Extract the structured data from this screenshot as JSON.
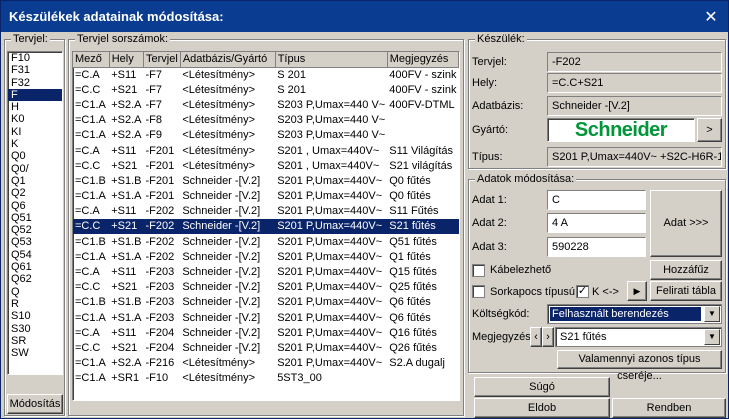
{
  "window": {
    "title": "Készülékek adatainak módosítása:",
    "close_glyph": "✕"
  },
  "left": {
    "legend": "Tervjel:",
    "items": [
      "F10",
      "F31",
      "F32",
      "F",
      "H",
      "K0",
      "KI",
      "K",
      "Q0",
      "Q0/",
      "Q1",
      "Q2",
      "Q6",
      "Q51",
      "Q52",
      "Q53",
      "Q54",
      "Q61",
      "Q62",
      "Q",
      "R",
      "S10",
      "S30",
      "SR",
      "SW"
    ],
    "selected_index": 3,
    "modositas_button": "Módosítás"
  },
  "table": {
    "legend": "Tervjel sorszámok:",
    "columns": [
      "Mező",
      "Hely",
      "Tervjel",
      "Adatbázis/Gyártó",
      "Típus",
      "Megjegyzés"
    ],
    "selected_row": 10,
    "rows": [
      [
        "=C.A",
        "+S11",
        "-F7",
        "<Létesítmény>",
        "S 201",
        "400FV - szink"
      ],
      [
        "=C.C",
        "+S21",
        "-F7",
        "<Létesítmény>",
        "S 201",
        "400FV - szink"
      ],
      [
        "=C1.A",
        "+S2.A",
        "-F7",
        "<Létesítmény>",
        "S203 P,Umax=440 V~",
        "400FV-DTML"
      ],
      [
        "=C1.A",
        "+S2.A",
        "-F8",
        "<Létesítmény>",
        "S203 P,Umax=440 V~",
        ""
      ],
      [
        "=C1.A",
        "+S2.A",
        "-F9",
        "<Létesítmény>",
        "S203 P,Umax=440 V~",
        ""
      ],
      [
        "=C.A",
        "+S11",
        "-F201",
        "<Létesítmény>",
        "S201 , Umax=440V~",
        "S11 Világítás"
      ],
      [
        "=C.C",
        "+S21",
        "-F201",
        "<Létesítmény>",
        "S201 , Umax=440V~",
        "S21 világítás"
      ],
      [
        "=C1.B",
        "+S1.B",
        "-F201",
        "Schneider -[V.2]",
        "S201 P,Umax=440V~",
        "Q0 fűtés"
      ],
      [
        "=C1.A",
        "+S1.A",
        "-F201",
        "Schneider -[V.2]",
        "S201 P,Umax=440V~",
        "Q0 fűtés"
      ],
      [
        "=C.A",
        "+S11",
        "-F202",
        "Schneider -[V.2]",
        "S201 P,Umax=440V~",
        "S11 Fűtés"
      ],
      [
        "=C.C",
        "+S21",
        "-F202",
        "Schneider -[V.2]",
        "S201 P,Umax=440V~",
        "S21 fűtés"
      ],
      [
        "=C1.B",
        "+S1.B",
        "-F202",
        "Schneider -[V.2]",
        "S201 P,Umax=440V~",
        "Q51 fűtés"
      ],
      [
        "=C1.A",
        "+S1.A",
        "-F202",
        "Schneider -[V.2]",
        "S201 P,Umax=440V~",
        "Q1 fűtés"
      ],
      [
        "=C.A",
        "+S11",
        "-F203",
        "Schneider -[V.2]",
        "S201 P,Umax=440V~",
        "Q15 fűtés"
      ],
      [
        "=C.C",
        "+S21",
        "-F203",
        "Schneider -[V.2]",
        "S201 P,Umax=440V~",
        "Q25 fűtés"
      ],
      [
        "=C1.B",
        "+S1.B",
        "-F203",
        "Schneider -[V.2]",
        "S201 P,Umax=440V~",
        "Q6 fűtés"
      ],
      [
        "=C1.A",
        "+S1.A",
        "-F203",
        "Schneider -[V.2]",
        "S201 P,Umax=440V~",
        "Q6 fűtés"
      ],
      [
        "=C.A",
        "+S11",
        "-F204",
        "Schneider -[V.2]",
        "S201 P,Umax=440V~",
        "Q16 fűtés"
      ],
      [
        "=C.C",
        "+S21",
        "-F204",
        "Schneider -[V.2]",
        "S201 P,Umax=440V~",
        "Q26 fűtés"
      ],
      [
        "=C1.A",
        "+S2.A",
        "-F216",
        "<Létesítmény>",
        "S201 P,Umax=440V~",
        "S2.A dugalj"
      ],
      [
        "=C1.A",
        "+SR1",
        "-F10",
        "<Létesítmény>",
        "5ST3_00",
        ""
      ]
    ]
  },
  "keszulek": {
    "legend": "Készülék:",
    "tervjel_label": "Tervjel:",
    "tervjel_value": "-F202",
    "hely_label": "Hely:",
    "hely_value": "=C.C+S21",
    "adatbazis_label": "Adatbázis:",
    "adatbazis_value": "Schneider -[V.2]",
    "gyarto_label": "Gyártó:",
    "gyarto_logo": "Schneider",
    "gyarto_btn": ">",
    "tipus_label": "Típus:",
    "tipus_value": "S201 P,Umax=440V~ +S2C-H6R-1",
    "logo_color": "#009639"
  },
  "adatok": {
    "legend": "Adatok módosítása:",
    "adat1_label": "Adat 1:",
    "adat1_value": "C",
    "adat2_label": "Adat 2:",
    "adat2_value": "4 A",
    "adat3_label": "Adat 3:",
    "adat3_value": "590228",
    "adat_btn": "Adat >>>",
    "kabelezheto_label": "Kábelezhető",
    "hozzafuz_btn": "Hozzáfűz",
    "sorkapocs_label": "Sorkapocs típusú",
    "k_label": "K <->",
    "play_btn": "▶",
    "felirati_btn": "Felirati tábla",
    "koltseg_label": "Költségkód:",
    "koltseg_value": "Felhasznált berendezés",
    "megj_label": "Megjegyzés:",
    "megj_value": "S21 fűtés",
    "csere_btn": "Valamennyi azonos típus cseréje..."
  },
  "footer": {
    "sugo": "Súgó",
    "eldob": "Eldob",
    "rendben": "Rendben"
  }
}
